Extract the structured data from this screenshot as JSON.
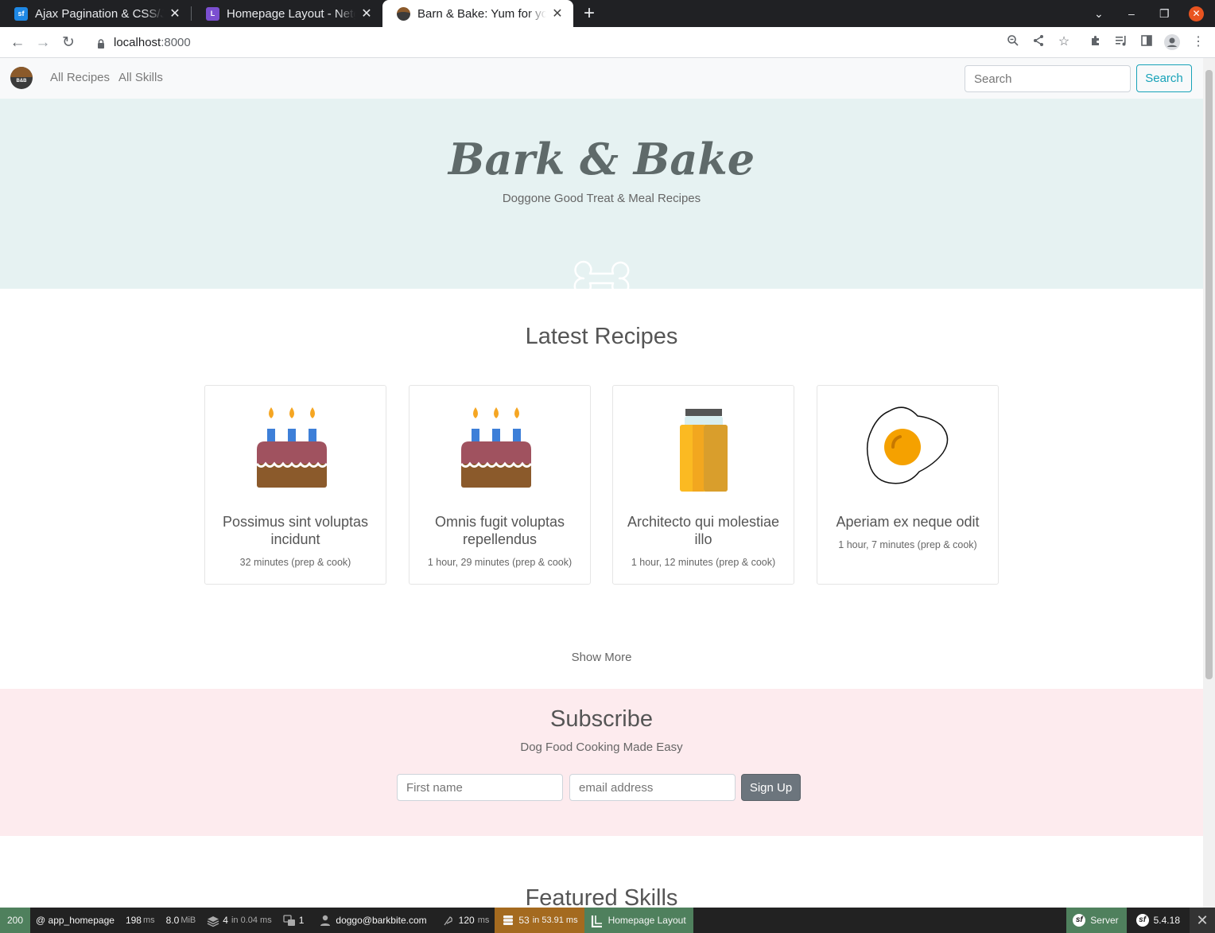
{
  "browser": {
    "tabs": [
      {
        "title": "Ajax Pagination & CSS/JS",
        "favicon": "symfonycasts-icon",
        "color": "#1e88e5",
        "active": false
      },
      {
        "title": "Homepage Layout - Netgen",
        "favicon": "netgen-layouts-icon",
        "color": "#7b4fd0",
        "active": false
      },
      {
        "title": "Barn & Bake: Yum for your",
        "favicon": "bark-bake-icon",
        "color": "#8b5a2b",
        "active": true
      }
    ],
    "new_tab": "+",
    "url_host": "localhost",
    "url_port": ":8000"
  },
  "site": {
    "logo_text": "B&B",
    "nav": [
      "All Recipes",
      "All Skills"
    ],
    "search_placeholder": "Search",
    "search_button": "Search"
  },
  "hero": {
    "title": "Bark & Bake",
    "tagline": "Doggone Good Treat & Meal Recipes",
    "icon": "bone-icon"
  },
  "latest": {
    "heading": "Latest Recipes",
    "recipes": [
      {
        "title": "Possimus sint voluptas incidunt",
        "time": "32 minutes (prep & cook)",
        "icon": "birthday-cake-icon"
      },
      {
        "title": "Omnis fugit voluptas repellendus",
        "time": "1 hour, 29 minutes (prep & cook)",
        "icon": "birthday-cake-icon"
      },
      {
        "title": "Architecto qui molestiae illo",
        "time": "1 hour, 12 minutes (prep & cook)",
        "icon": "honey-jar-icon"
      },
      {
        "title": "Aperiam ex neque odit",
        "time": "1 hour, 7 minutes (prep & cook)",
        "icon": "fried-egg-icon"
      }
    ],
    "show_more": "Show More"
  },
  "subscribe": {
    "heading": "Subscribe",
    "subheading": "Dog Food Cooking Made Easy",
    "first_name_placeholder": "First name",
    "email_placeholder": "email address",
    "button": "Sign Up"
  },
  "featured": {
    "heading": "Featured Skills"
  },
  "sf_toolbar": {
    "status": "200",
    "status_color": "#4f805d",
    "route": "@ app_homepage",
    "time_value": "198",
    "time_unit": "ms",
    "memory_value": "8.0",
    "memory_unit": "MiB",
    "cache_value": "4",
    "cache_text": "in 0.04 ms",
    "translation_count": "1",
    "user": "doggo@barkbite.com",
    "logger_value": "120",
    "logger_unit": "ms",
    "db_value": "53",
    "db_text": "in 53.91 ms",
    "db_color": "#a46a1f",
    "layout_label": "Homepage Layout",
    "layout_color": "#4f805d",
    "server_label": "Server",
    "version": "5.4.18"
  }
}
